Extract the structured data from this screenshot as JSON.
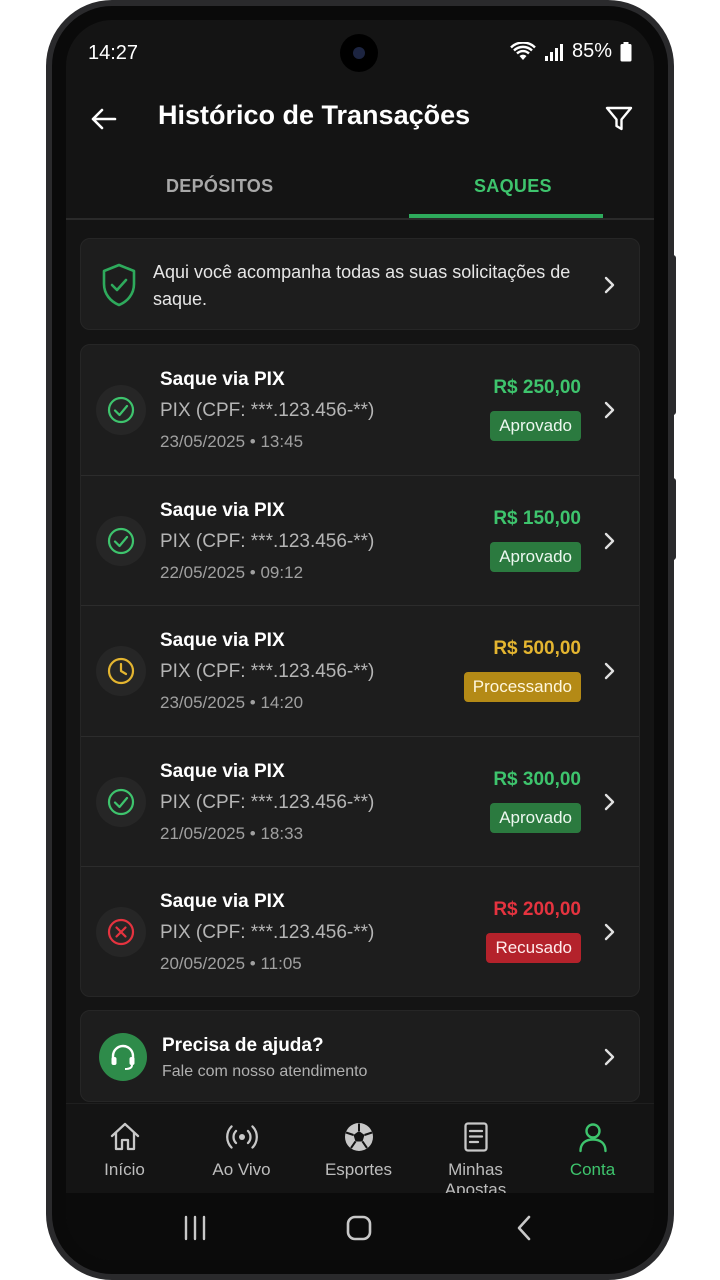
{
  "status_bar": {
    "time": "14:27",
    "battery": "85%"
  },
  "header": {
    "title": "Histórico de Transações"
  },
  "tabs": [
    {
      "label": "DEPÓSITOS",
      "active": false
    },
    {
      "label": "SAQUES",
      "active": true
    }
  ],
  "info_card": {
    "text": "Aqui você acompanha todas as suas solicitações de saque.",
    "icon": "shield-check-icon"
  },
  "transactions": [
    {
      "title": "Saque via PIX",
      "method": "PIX (CPF: ***.123.456-**)",
      "date": "23/05/2025 • 13:45",
      "amount": "R$ 250,00",
      "status": "Aprovado",
      "status_type": "approved"
    },
    {
      "title": "Saque via PIX",
      "method": "PIX (CPF: ***.123.456-**)",
      "date": "22/05/2025 • 09:12",
      "amount": "R$ 150,00",
      "status": "Aprovado",
      "status_type": "approved"
    },
    {
      "title": "Saque via PIX",
      "method": "PIX (CPF: ***.123.456-**)",
      "date": "23/05/2025 • 14:20",
      "amount": "R$ 500,00",
      "status": "Processando",
      "status_type": "processing"
    },
    {
      "title": "Saque via PIX",
      "method": "PIX (CPF: ***.123.456-**)",
      "date": "21/05/2025 • 18:33",
      "amount": "R$ 300,00",
      "status": "Aprovado",
      "status_type": "approved"
    },
    {
      "title": "Saque via PIX",
      "method": "PIX (CPF: ***.123.456-**)",
      "date": "20/05/2025 • 11:05",
      "amount": "R$ 200,00",
      "status": "Recusado",
      "status_type": "refused"
    }
  ],
  "help_card": {
    "title": "Precisa de ajuda?",
    "subtitle": "Fale com nosso atendimento"
  },
  "bottom_nav": [
    {
      "label": "Início",
      "icon": "home-icon",
      "active": false
    },
    {
      "label": "Ao Vivo",
      "icon": "live-icon",
      "active": false
    },
    {
      "label": "Esportes",
      "icon": "soccer-ball-icon",
      "active": false
    },
    {
      "label": "Minhas Apostas",
      "icon": "receipt-icon",
      "active": false
    },
    {
      "label": "Conta",
      "icon": "user-icon",
      "active": true
    }
  ],
  "colors": {
    "accent_green": "#3ec46d",
    "pending_yellow": "#e4b530",
    "refused_red": "#e5333f",
    "background": "#141414",
    "card": "#1d1d1d"
  }
}
